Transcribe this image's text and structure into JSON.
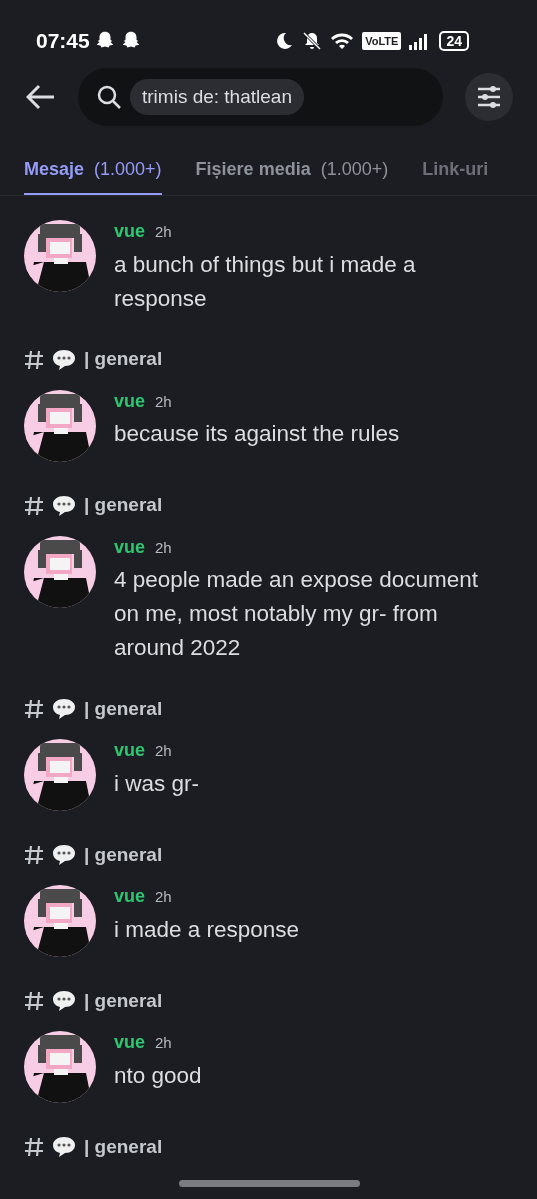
{
  "status_bar": {
    "time": "07:45",
    "network": "VoLTE",
    "battery": "24"
  },
  "search": {
    "query": "trimis de: thatlean"
  },
  "tabs": [
    {
      "label": "Mesaje",
      "count": "(1.000+)",
      "selected": true
    },
    {
      "label": "Fișiere media",
      "count": "(1.000+)",
      "selected": false
    },
    {
      "label": "Link-uri",
      "selected": false
    }
  ],
  "feed": [
    {
      "kind": "message",
      "author": "vue",
      "time": "2h",
      "text": "a bunch of things but i made a response"
    },
    {
      "kind": "channel",
      "name": "| general"
    },
    {
      "kind": "message",
      "author": "vue",
      "time": "2h",
      "text": "because its against the rules"
    },
    {
      "kind": "channel",
      "name": "| general"
    },
    {
      "kind": "message",
      "author": "vue",
      "time": "2h",
      "text": "4 people made an expose document on me, most notably my gr- from around 2022"
    },
    {
      "kind": "channel",
      "name": "| general"
    },
    {
      "kind": "message",
      "author": "vue",
      "time": "2h",
      "text": "i was gr-"
    },
    {
      "kind": "channel",
      "name": "| general"
    },
    {
      "kind": "message",
      "author": "vue",
      "time": "2h",
      "text": "i made a response"
    },
    {
      "kind": "channel",
      "name": "| general"
    },
    {
      "kind": "message",
      "author": "vue",
      "time": "2h",
      "text": "nto good"
    },
    {
      "kind": "channel",
      "name": "| general"
    }
  ]
}
